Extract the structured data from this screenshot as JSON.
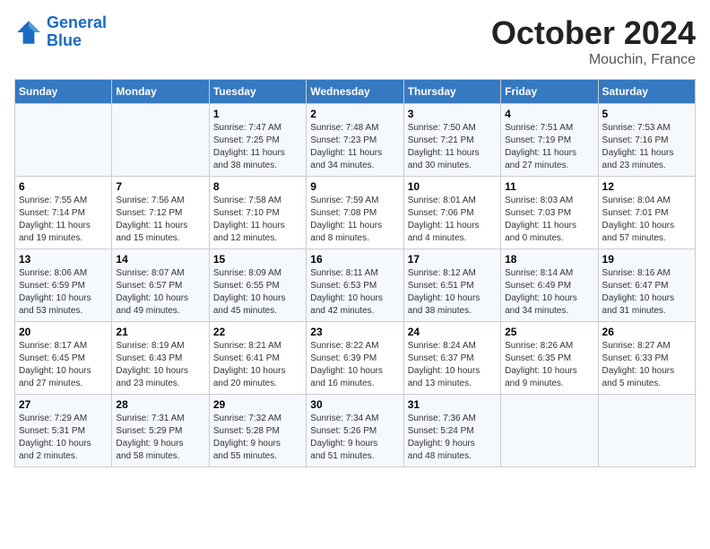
{
  "header": {
    "logo_line1": "General",
    "logo_line2": "Blue",
    "month": "October 2024",
    "location": "Mouchin, France"
  },
  "days_of_week": [
    "Sunday",
    "Monday",
    "Tuesday",
    "Wednesday",
    "Thursday",
    "Friday",
    "Saturday"
  ],
  "weeks": [
    [
      {
        "num": "",
        "info": ""
      },
      {
        "num": "",
        "info": ""
      },
      {
        "num": "1",
        "info": "Sunrise: 7:47 AM\nSunset: 7:25 PM\nDaylight: 11 hours\nand 38 minutes."
      },
      {
        "num": "2",
        "info": "Sunrise: 7:48 AM\nSunset: 7:23 PM\nDaylight: 11 hours\nand 34 minutes."
      },
      {
        "num": "3",
        "info": "Sunrise: 7:50 AM\nSunset: 7:21 PM\nDaylight: 11 hours\nand 30 minutes."
      },
      {
        "num": "4",
        "info": "Sunrise: 7:51 AM\nSunset: 7:19 PM\nDaylight: 11 hours\nand 27 minutes."
      },
      {
        "num": "5",
        "info": "Sunrise: 7:53 AM\nSunset: 7:16 PM\nDaylight: 11 hours\nand 23 minutes."
      }
    ],
    [
      {
        "num": "6",
        "info": "Sunrise: 7:55 AM\nSunset: 7:14 PM\nDaylight: 11 hours\nand 19 minutes."
      },
      {
        "num": "7",
        "info": "Sunrise: 7:56 AM\nSunset: 7:12 PM\nDaylight: 11 hours\nand 15 minutes."
      },
      {
        "num": "8",
        "info": "Sunrise: 7:58 AM\nSunset: 7:10 PM\nDaylight: 11 hours\nand 12 minutes."
      },
      {
        "num": "9",
        "info": "Sunrise: 7:59 AM\nSunset: 7:08 PM\nDaylight: 11 hours\nand 8 minutes."
      },
      {
        "num": "10",
        "info": "Sunrise: 8:01 AM\nSunset: 7:06 PM\nDaylight: 11 hours\nand 4 minutes."
      },
      {
        "num": "11",
        "info": "Sunrise: 8:03 AM\nSunset: 7:03 PM\nDaylight: 11 hours\nand 0 minutes."
      },
      {
        "num": "12",
        "info": "Sunrise: 8:04 AM\nSunset: 7:01 PM\nDaylight: 10 hours\nand 57 minutes."
      }
    ],
    [
      {
        "num": "13",
        "info": "Sunrise: 8:06 AM\nSunset: 6:59 PM\nDaylight: 10 hours\nand 53 minutes."
      },
      {
        "num": "14",
        "info": "Sunrise: 8:07 AM\nSunset: 6:57 PM\nDaylight: 10 hours\nand 49 minutes."
      },
      {
        "num": "15",
        "info": "Sunrise: 8:09 AM\nSunset: 6:55 PM\nDaylight: 10 hours\nand 45 minutes."
      },
      {
        "num": "16",
        "info": "Sunrise: 8:11 AM\nSunset: 6:53 PM\nDaylight: 10 hours\nand 42 minutes."
      },
      {
        "num": "17",
        "info": "Sunrise: 8:12 AM\nSunset: 6:51 PM\nDaylight: 10 hours\nand 38 minutes."
      },
      {
        "num": "18",
        "info": "Sunrise: 8:14 AM\nSunset: 6:49 PM\nDaylight: 10 hours\nand 34 minutes."
      },
      {
        "num": "19",
        "info": "Sunrise: 8:16 AM\nSunset: 6:47 PM\nDaylight: 10 hours\nand 31 minutes."
      }
    ],
    [
      {
        "num": "20",
        "info": "Sunrise: 8:17 AM\nSunset: 6:45 PM\nDaylight: 10 hours\nand 27 minutes."
      },
      {
        "num": "21",
        "info": "Sunrise: 8:19 AM\nSunset: 6:43 PM\nDaylight: 10 hours\nand 23 minutes."
      },
      {
        "num": "22",
        "info": "Sunrise: 8:21 AM\nSunset: 6:41 PM\nDaylight: 10 hours\nand 20 minutes."
      },
      {
        "num": "23",
        "info": "Sunrise: 8:22 AM\nSunset: 6:39 PM\nDaylight: 10 hours\nand 16 minutes."
      },
      {
        "num": "24",
        "info": "Sunrise: 8:24 AM\nSunset: 6:37 PM\nDaylight: 10 hours\nand 13 minutes."
      },
      {
        "num": "25",
        "info": "Sunrise: 8:26 AM\nSunset: 6:35 PM\nDaylight: 10 hours\nand 9 minutes."
      },
      {
        "num": "26",
        "info": "Sunrise: 8:27 AM\nSunset: 6:33 PM\nDaylight: 10 hours\nand 5 minutes."
      }
    ],
    [
      {
        "num": "27",
        "info": "Sunrise: 7:29 AM\nSunset: 5:31 PM\nDaylight: 10 hours\nand 2 minutes."
      },
      {
        "num": "28",
        "info": "Sunrise: 7:31 AM\nSunset: 5:29 PM\nDaylight: 9 hours\nand 58 minutes."
      },
      {
        "num": "29",
        "info": "Sunrise: 7:32 AM\nSunset: 5:28 PM\nDaylight: 9 hours\nand 55 minutes."
      },
      {
        "num": "30",
        "info": "Sunrise: 7:34 AM\nSunset: 5:26 PM\nDaylight: 9 hours\nand 51 minutes."
      },
      {
        "num": "31",
        "info": "Sunrise: 7:36 AM\nSunset: 5:24 PM\nDaylight: 9 hours\nand 48 minutes."
      },
      {
        "num": "",
        "info": ""
      },
      {
        "num": "",
        "info": ""
      }
    ]
  ]
}
